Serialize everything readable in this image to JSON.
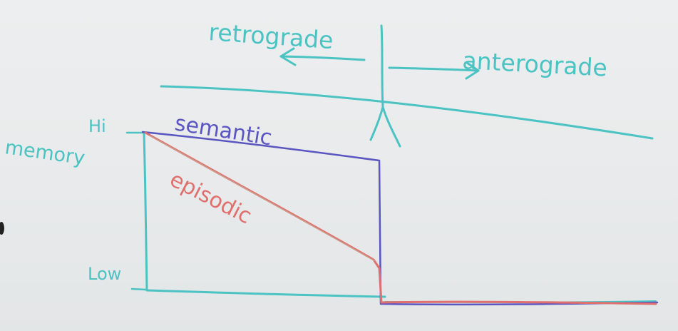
{
  "labels": {
    "retrograde": "retrograde",
    "anterograde": "anterograde",
    "memory": "memory",
    "hi": "Hi",
    "low": "Low",
    "semantic": "semantic",
    "episodic": "episodic"
  },
  "colors": {
    "teal": "#4cc3c3",
    "blue": "#5a55c0",
    "red": "#e0706e",
    "board": "#eaeced"
  }
}
